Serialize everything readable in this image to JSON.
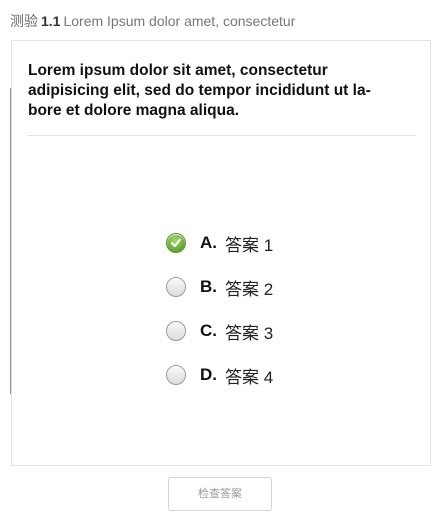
{
  "header": {
    "prefix": "测验",
    "number": "1.1",
    "title": "Lorem Ipsum dolor amet, consectetur"
  },
  "question": {
    "text": "Lorem ipsum dolor sit amet, consectetur adipisicing elit, sed do tempor incididunt ut la-bore et dolore magna aliqua."
  },
  "options": [
    {
      "letter": "A.",
      "text": "答案 1",
      "checked": true
    },
    {
      "letter": "B.",
      "text": "答案 2",
      "checked": false
    },
    {
      "letter": "C.",
      "text": "答案 3",
      "checked": false
    },
    {
      "letter": "D.",
      "text": "答案 4",
      "checked": false
    }
  ],
  "check_button": {
    "label": "检查答案"
  },
  "icons": {
    "selected": "check-circle-icon",
    "unselected": "radio-empty-icon"
  },
  "colors": {
    "accent_green": "#6aac3a",
    "button_text": "#9a9a9a"
  }
}
